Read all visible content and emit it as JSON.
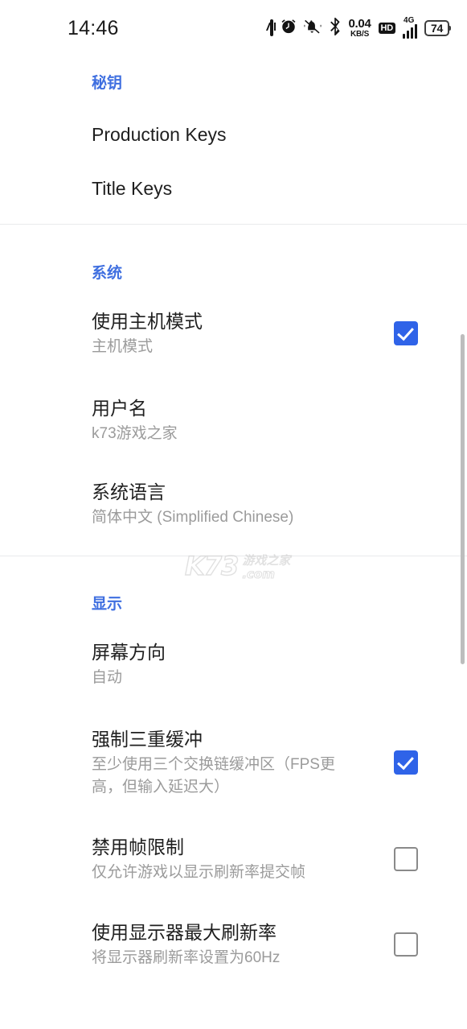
{
  "statusbar": {
    "time": "14:46",
    "icons": [
      {
        "name": "nfc-icon",
        "label": "NFC"
      },
      {
        "name": "alarm-icon",
        "label": "Alarm"
      },
      {
        "name": "mute-icon",
        "label": "Ringer muted"
      },
      {
        "name": "bluetooth-icon",
        "label": "Bluetooth"
      },
      {
        "name": "data-speed-icon",
        "label": "0.04 KB/S"
      },
      {
        "name": "hd-icon",
        "label": "HD"
      },
      {
        "name": "signal-icon",
        "label": "4G"
      },
      {
        "name": "battery-icon",
        "label": "74"
      }
    ],
    "data_speed_value": "0.04",
    "data_speed_unit": "KB/S",
    "hd_label": "HD",
    "network_label": "4G",
    "battery_level": "74"
  },
  "colors": {
    "accent": "#3f6fe0",
    "checkbox_on": "#2f63e8",
    "checkbox_off_border": "#8a8a8a",
    "title_text": "#1f1f1f",
    "subtitle_text": "#9b9b9b",
    "divider": "#e9eaec",
    "scrollbar": "#bdbdbd"
  },
  "watermark": {
    "logo": "K73",
    "cn": "游戏之家",
    "domain": ".com"
  },
  "sections": [
    {
      "id": "keys",
      "title": "秘钥",
      "rows": [
        {
          "name": "production-keys",
          "title": "Production Keys",
          "subtitle": "",
          "checkbox": "none"
        },
        {
          "name": "title-keys",
          "title": "Title Keys",
          "subtitle": "",
          "checkbox": "none"
        }
      ]
    },
    {
      "id": "system",
      "title": "系统",
      "rows": [
        {
          "name": "use-docked-mode",
          "title": "使用主机模式",
          "subtitle": "主机模式",
          "checkbox": "checked"
        },
        {
          "name": "username",
          "title": "用户名",
          "subtitle": "k73游戏之家",
          "checkbox": "none"
        },
        {
          "name": "system-language",
          "title": "系统语言",
          "subtitle": "简体中文 (Simplified Chinese)",
          "checkbox": "none"
        }
      ]
    },
    {
      "id": "display",
      "title": "显示",
      "rows": [
        {
          "name": "screen-orientation",
          "title": "屏幕方向",
          "subtitle": "自动",
          "checkbox": "none"
        },
        {
          "name": "force-triple-buffering",
          "title": "强制三重缓冲",
          "subtitle": "至少使用三个交换链缓冲区（FPS更高，但输入延迟大）",
          "checkbox": "checked"
        },
        {
          "name": "disable-frame-limit",
          "title": "禁用帧限制",
          "subtitle": "仅允许游戏以显示刷新率提交帧",
          "checkbox": "unchecked"
        },
        {
          "name": "use-max-refresh-rate",
          "title": "使用显示器最大刷新率",
          "subtitle": "将显示器刷新率设置为60Hz",
          "checkbox": "unchecked"
        }
      ]
    }
  ]
}
